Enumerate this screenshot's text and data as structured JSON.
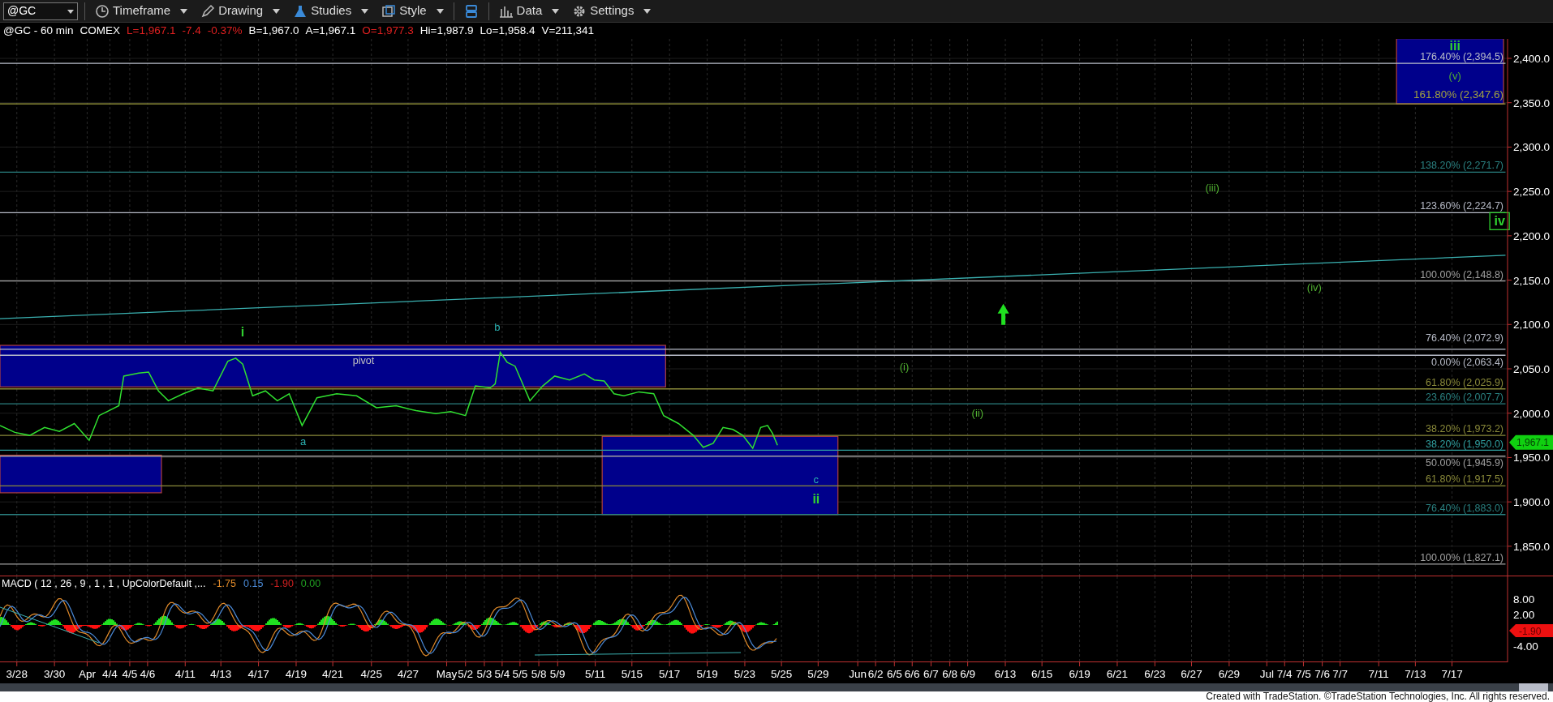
{
  "toolbar": {
    "symbol": "@GC",
    "buttons": [
      {
        "label": "Timeframe",
        "kind": "clock"
      },
      {
        "label": "Drawing",
        "kind": "pencil"
      },
      {
        "label": "Studies",
        "kind": "flask"
      },
      {
        "label": "Style",
        "kind": "square"
      },
      {
        "kind": "layout"
      },
      {
        "label": "Data",
        "kind": "bars"
      },
      {
        "label": "Settings",
        "kind": "gear"
      }
    ]
  },
  "status_line": [
    {
      "text": "@GC - 60 min",
      "color": "#ffffff"
    },
    {
      "text": "COMEX",
      "color": "#ffffff"
    },
    {
      "text": "L=1,967.1",
      "color": "#e02020"
    },
    {
      "text": "-7.4",
      "color": "#e02020"
    },
    {
      "text": "-0.37%",
      "color": "#e02020"
    },
    {
      "text": "B=1,967.0",
      "color": "#ffffff"
    },
    {
      "text": "A=1,967.1",
      "color": "#ffffff"
    },
    {
      "text": "O=1,977.3",
      "color": "#e02020"
    },
    {
      "text": "Hi=1,987.9",
      "color": "#ffffff"
    },
    {
      "text": "Lo=1,958.4",
      "color": "#ffffff"
    },
    {
      "text": "V=211,341",
      "color": "#ffffff"
    }
  ],
  "price_panel": {
    "fib_levels": [
      {
        "label": "176.40% (2,394.5)",
        "color": "#b8bcc8"
      },
      {
        "label": "161.80% (2,347.6)",
        "color": "#a0a040"
      },
      {
        "label": "138.20% (2,271.7)",
        "color": "#2a8080"
      },
      {
        "label": "123.60% (2,224.7)",
        "color": "#b8bcc8"
      },
      {
        "label": "100.00% (2,148.8)",
        "color": "#a0a0a0"
      },
      {
        "label": "76.40% (2,072.9)",
        "color": "#b8bcc8"
      },
      {
        "label": "0.00% (2,063.4)",
        "color": "#b8bcc8"
      },
      {
        "label": "61.80% (2,025.9)",
        "color": "#8a8a3a"
      },
      {
        "label": "23.60% (2,007.7)",
        "color": "#2a8080"
      },
      {
        "label": "38.20% (1,973.2)",
        "color": "#8a8a3a"
      },
      {
        "label": "38.20% (1,950.0)",
        "color": "#30a0a0"
      },
      {
        "label": "50.00% (1,945.9)",
        "color": "#a0a0a0"
      },
      {
        "label": "61.80% (1,917.5)",
        "color": "#8a8a3a"
      },
      {
        "label": "76.40% (1,883.0)",
        "color": "#2a8080"
      },
      {
        "label": "100.00% (1,827.1)",
        "color": "#a0a0a0"
      }
    ],
    "wave_labels": [
      {
        "text": "iii",
        "kind": "major"
      },
      {
        "text": "(v)",
        "kind": "minor"
      },
      {
        "text": "(iii)",
        "kind": "minor"
      },
      {
        "text": "iv",
        "kind": "boxed"
      },
      {
        "text": "(iv)",
        "kind": "minor"
      },
      {
        "text": "i",
        "kind": "major"
      },
      {
        "text": "b",
        "kind": "corrective"
      },
      {
        "text": "pivot",
        "kind": "note"
      },
      {
        "text": "(i)",
        "kind": "minor"
      },
      {
        "text": "(ii)",
        "kind": "minor"
      },
      {
        "text": "a",
        "kind": "corrective"
      },
      {
        "text": "c",
        "kind": "corrective"
      },
      {
        "text": "ii",
        "kind": "major"
      }
    ],
    "y_axis": [
      "2,400.0",
      "2,350.0",
      "2,300.0",
      "2,250.0",
      "2,200.0",
      "2,150.0",
      "2,100.0",
      "2,050.0",
      "2,000.0",
      "1,950.0",
      "1,900.0",
      "1,850.0"
    ],
    "last_price": "1,967.1"
  },
  "macd_panel": {
    "title": "MACD ( 12 , 26 , 9 , 1 , 1 , UpColorDefault ,...",
    "values": [
      {
        "text": "-1.75",
        "color": "#e08a2a"
      },
      {
        "text": "0.15",
        "color": "#4a8ad8"
      },
      {
        "text": "-1.90",
        "color": "#d02020"
      },
      {
        "text": "0.00",
        "color": "#20a020"
      }
    ],
    "y_axis": [
      "8.00",
      "2.00",
      "-4.00"
    ],
    "last_value": "-1.90"
  },
  "date_axis": [
    "3/28",
    "3/30",
    "Apr",
    "4/4",
    "4/5",
    "4/6",
    "4/11",
    "4/13",
    "4/17",
    "4/19",
    "4/21",
    "4/25",
    "4/27",
    "May",
    "5/2",
    "5/3",
    "5/4",
    "5/5",
    "5/8",
    "5/9",
    "5/11",
    "5/15",
    "5/17",
    "5/19",
    "5/23",
    "5/25",
    "5/29",
    "Jun",
    "6/2",
    "6/5",
    "6/6",
    "6/7",
    "6/8",
    "6/9",
    "6/13",
    "6/15",
    "6/19",
    "6/21",
    "6/23",
    "6/27",
    "6/29",
    "Jul",
    "7/4",
    "7/5",
    "7/6",
    "7/7",
    "7/11",
    "7/13",
    "7/17"
  ],
  "footer": "Created with TradeStation. ©TradeStation Technologies, Inc. All rights reserved."
}
